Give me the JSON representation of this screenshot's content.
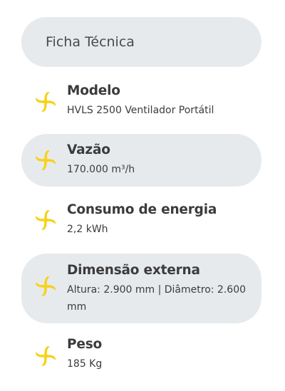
{
  "header": {
    "title": "Ficha Técnica"
  },
  "colors": {
    "accent": "#F6D21B",
    "pill_bg": "#E7EAED",
    "text": "#3B3B3B"
  },
  "specs": [
    {
      "label": "Modelo",
      "value": "HVLS 2500 Ventilador Portátil",
      "icon": "fan-icon"
    },
    {
      "label": "Vazão",
      "value": "170.000 m³/h",
      "icon": "fan-icon"
    },
    {
      "label": "Consumo de energia",
      "value": "2,2 kWh",
      "icon": "fan-icon"
    },
    {
      "label": "Dimensão externa",
      "value": "Altura: 2.900 mm | Diâmetro: 2.600 mm",
      "icon": "fan-icon"
    },
    {
      "label": "Peso",
      "value": "185 Kg",
      "icon": "fan-icon"
    }
  ]
}
